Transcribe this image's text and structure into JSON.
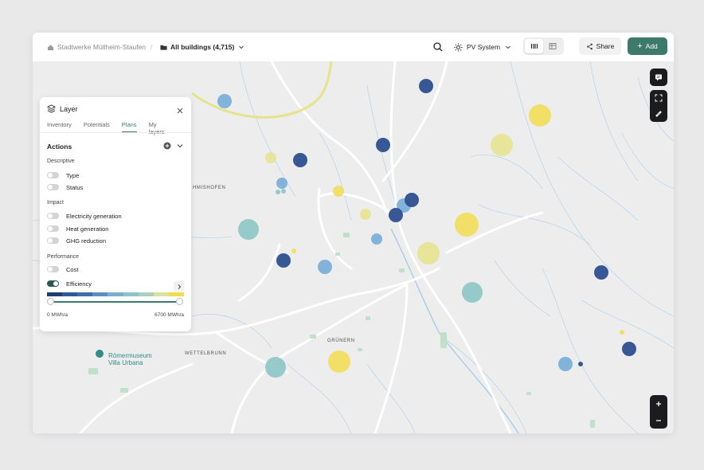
{
  "topbar": {
    "org_name": "Stadtwerke Müllheim-Staufen",
    "separator": "/",
    "building_scope": "All buildings (4,715)",
    "system_label": "PV System",
    "share_label": "Share",
    "add_symbol": "+",
    "add_label": "Add"
  },
  "map": {
    "places": [
      "HMISHOFEN",
      "WETTELBRUNN",
      "GRÜNERN"
    ],
    "poi_line1": "Römermuseum",
    "poi_line2": "Villa Urbana",
    "marker_colors": {
      "low": "#2e4f8f",
      "mid_low": "#6fa8d6",
      "mid": "#86c2c2",
      "mid_high": "#e6e28a",
      "high": "#f2dc4f"
    }
  },
  "layer_panel": {
    "title": "Layer",
    "tabs": [
      {
        "label": "Inventory",
        "active": false
      },
      {
        "label": "Potentials",
        "active": false
      },
      {
        "label": "Plans",
        "active": true
      },
      {
        "label": "My layers",
        "active": false
      }
    ],
    "actions_title": "Actions",
    "sections": {
      "descriptive": "Descriptive",
      "impact": "Impact",
      "performance": "Performance"
    },
    "items": {
      "type": {
        "label": "Type",
        "on": false
      },
      "status": {
        "label": "Status",
        "on": false
      },
      "electricity": {
        "label": "Electricity generation",
        "on": false
      },
      "heat": {
        "label": "Heat generation",
        "on": false
      },
      "ghg": {
        "label": "GHG reduction",
        "on": false
      },
      "cost": {
        "label": "Cost",
        "on": false
      },
      "efficiency": {
        "label": "Efficiency",
        "on": true
      }
    },
    "scale_colors": [
      "#1f3d73",
      "#2e5a9a",
      "#3d6fae",
      "#5b8fc4",
      "#7aaed0",
      "#8fc2c6",
      "#a9cfbe",
      "#d9e29a",
      "#f2dc4f"
    ],
    "range_min_label": "0 MWh/a",
    "range_max_label": "6700 MWh/a"
  }
}
